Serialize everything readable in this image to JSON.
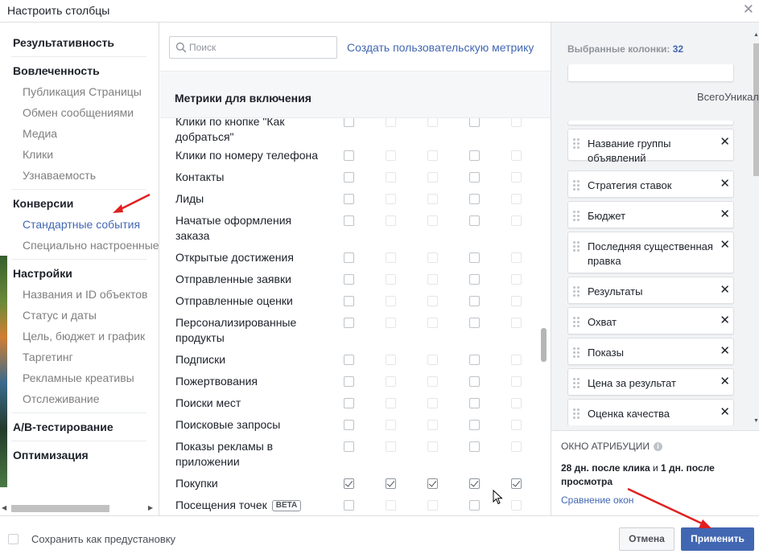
{
  "colors": {
    "accent": "#4267b2",
    "annotation": "#e02020"
  },
  "dialog": {
    "title": "Настроить столбцы",
    "close_icon": "close-icon"
  },
  "sidebar": {
    "sections": [
      {
        "label": "Результативность"
      },
      {
        "label": "Вовлеченность",
        "items": [
          "Публикация Страницы",
          "Обмен сообщениями",
          "Медиа",
          "Клики",
          "Узнаваемость"
        ]
      },
      {
        "label": "Конверсии",
        "items": [
          "Стандартные события",
          "Специально настроенные"
        ],
        "active_item": "Стандартные события"
      },
      {
        "label": "Настройки",
        "items": [
          "Названия и ID объектов",
          "Статус и даты",
          "Цель, бюджет и график",
          "Таргетинг",
          "Рекламные креативы",
          "Отслеживание"
        ]
      },
      {
        "label": "A/B-тестирование"
      },
      {
        "label": "Оптимизация"
      }
    ]
  },
  "search": {
    "placeholder": "Поиск",
    "value": ""
  },
  "create_metric_link": "Создать пользовательскую метрику",
  "metrics": {
    "header": "Метрики для включения",
    "column_headers": "ВсегоУникал",
    "rows": [
      {
        "label": "Клики по кнопке \"Как добраться\"",
        "checks": [
          false,
          false,
          false,
          false,
          false
        ]
      },
      {
        "label": "Клики по номеру телефона",
        "checks": [
          false,
          false,
          false,
          false,
          false
        ]
      },
      {
        "label": "Контакты",
        "checks": [
          false,
          false,
          false,
          false,
          false
        ]
      },
      {
        "label": "Лиды",
        "checks": [
          false,
          false,
          false,
          false,
          false
        ]
      },
      {
        "label": "Начатые оформления заказа",
        "checks": [
          false,
          false,
          false,
          false,
          false
        ]
      },
      {
        "label": "Открытые достижения",
        "checks": [
          false,
          false,
          false,
          false,
          false
        ]
      },
      {
        "label": "Отправленные заявки",
        "checks": [
          false,
          false,
          false,
          false,
          false
        ]
      },
      {
        "label": "Отправленные оценки",
        "checks": [
          false,
          false,
          false,
          false,
          false
        ]
      },
      {
        "label": "Персонализированные продукты",
        "checks": [
          false,
          false,
          false,
          false,
          false
        ]
      },
      {
        "label": "Подписки",
        "checks": [
          false,
          false,
          false,
          false,
          false
        ]
      },
      {
        "label": "Пожертвования",
        "checks": [
          false,
          false,
          false,
          false,
          false
        ]
      },
      {
        "label": "Поиски мест",
        "checks": [
          false,
          false,
          false,
          false,
          false
        ]
      },
      {
        "label": "Поисковые запросы",
        "checks": [
          false,
          false,
          false,
          false,
          false
        ]
      },
      {
        "label": "Показы рекламы в приложении",
        "checks": [
          false,
          false,
          false,
          false,
          false
        ]
      },
      {
        "label": "Покупки",
        "checks": [
          true,
          true,
          true,
          true,
          true
        ]
      },
      {
        "label": "Посещения точек",
        "badge": "BETA",
        "checks": [
          false,
          false,
          false,
          false,
          false
        ]
      }
    ]
  },
  "selected": {
    "title": "Выбранные колонки:",
    "count": "32",
    "items": [
      "Название группы объявлений",
      "Стратегия ставок",
      "Бюджет",
      "Последняя существенная правка",
      "Результаты",
      "Охват",
      "Показы",
      "Цена за результат",
      "Оценка качества"
    ]
  },
  "attribution": {
    "title": "ОКНО АТРИБУЦИИ",
    "info_icon": "info-icon",
    "desc_bold1": "28 дн. после клика",
    "desc_mid": " и ",
    "desc_bold2": "1 дн. после просмотра",
    "compare_link": "Сравнение окон"
  },
  "footer": {
    "save_preset_label": "Сохранить как предустановку",
    "cancel_label": "Отмена",
    "apply_label": "Применить"
  }
}
